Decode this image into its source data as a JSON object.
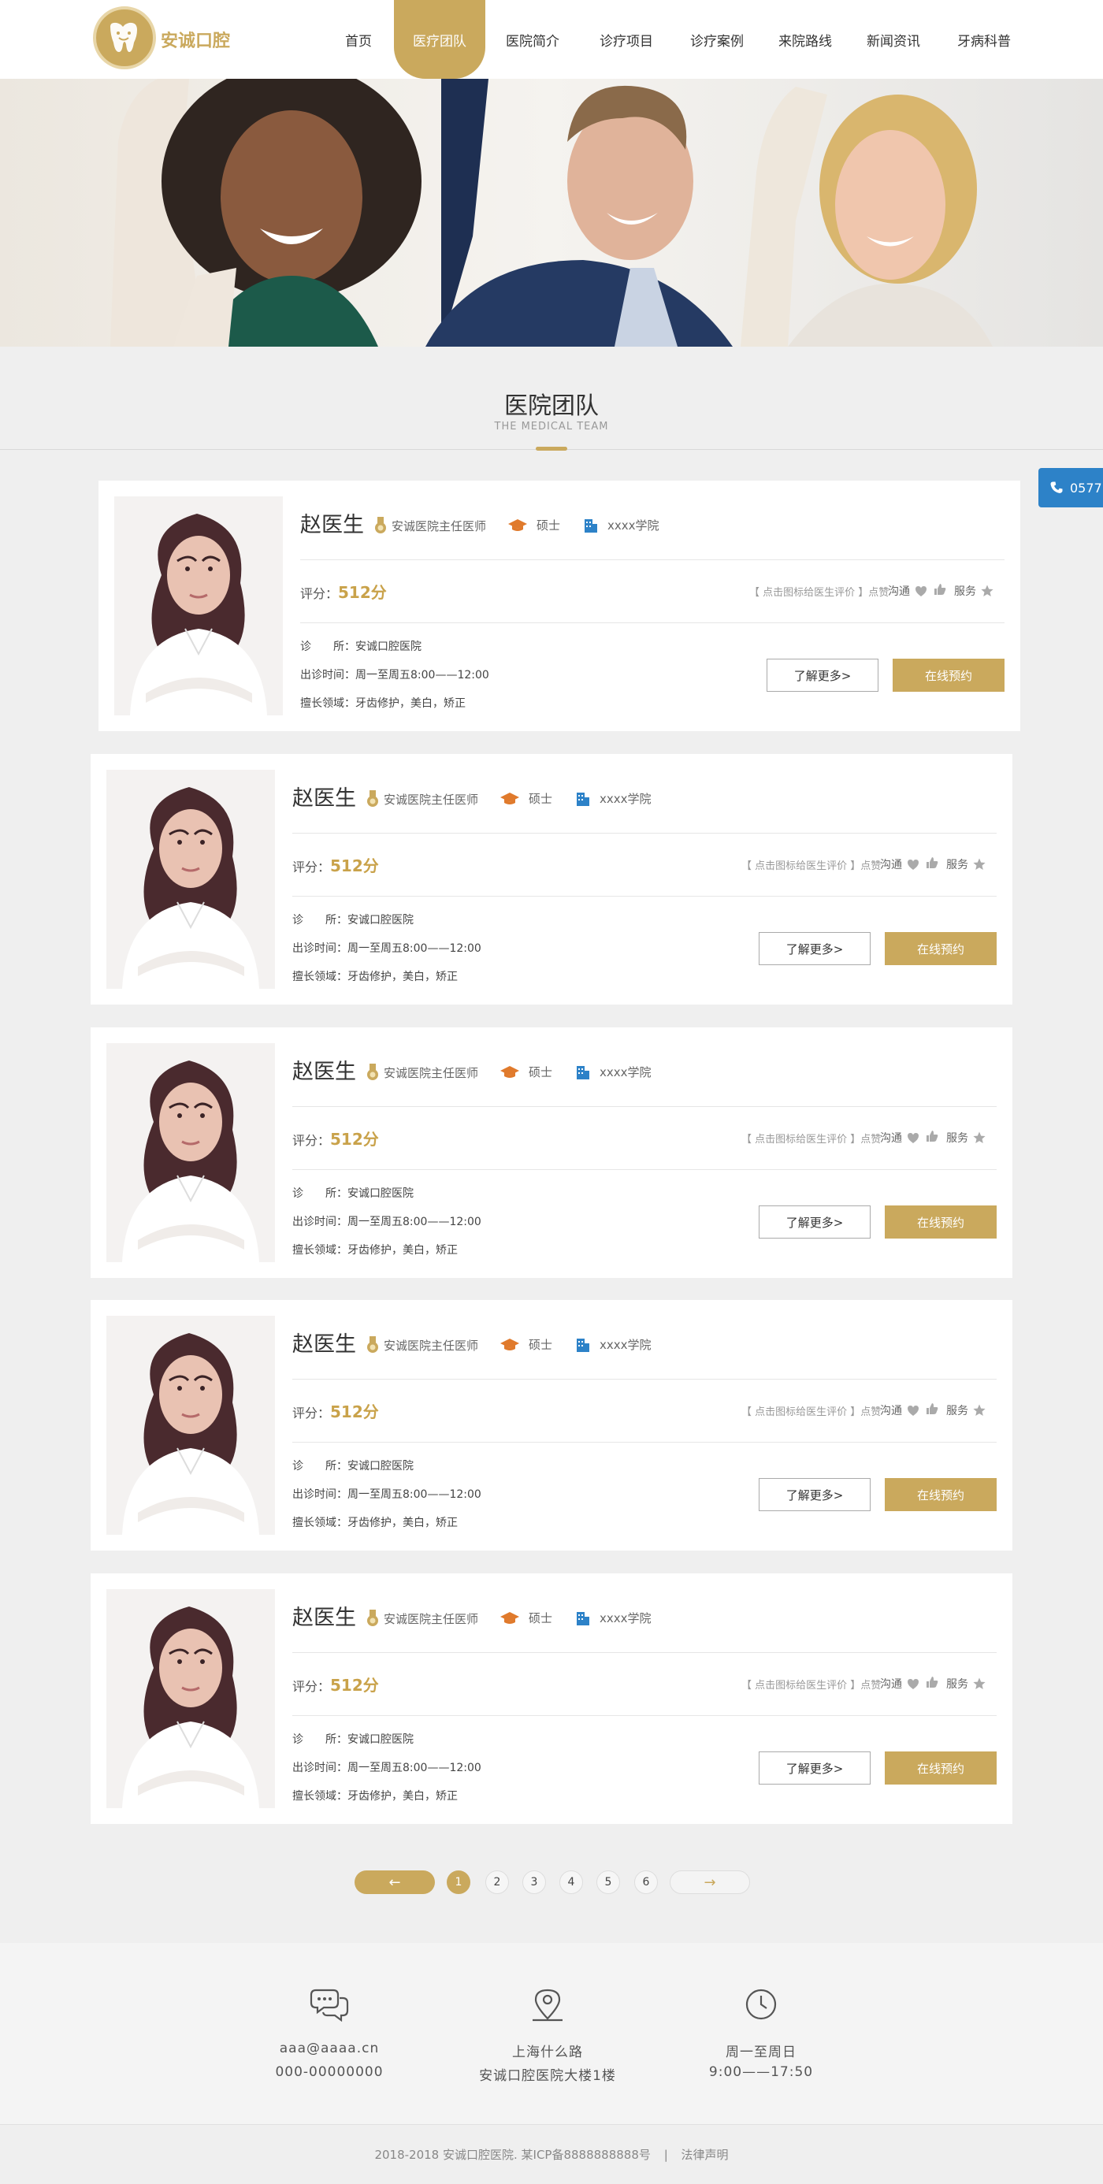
{
  "site": {
    "logo_text": "安诚口腔"
  },
  "nav": [
    {
      "label": "首页",
      "w": 90
    },
    {
      "label": "医疗团队",
      "w": 116,
      "active": true
    },
    {
      "label": "医院简介",
      "w": 120
    },
    {
      "label": "诊疗项目",
      "w": 118
    },
    {
      "label": "诊疗案例",
      "w": 112
    },
    {
      "label": "来院路线",
      "w": 112
    },
    {
      "label": "新闻资讯",
      "w": 112
    },
    {
      "label": "牙病科普",
      "w": 118
    }
  ],
  "section": {
    "title": "医院团队",
    "subtitle": "THE MEDICAL TEAM"
  },
  "tel_tab": {
    "label": "0577"
  },
  "doctor_card": {
    "name": "赵医生",
    "title": "安诚医院主任医师",
    "degree": "硕士",
    "school": "xxxx学院",
    "score_label": "评分：",
    "score": "512分",
    "hint": "【 点击图标给医生评价 】点赞",
    "communicate": "沟通",
    "service": "服务",
    "clinic": "诊　　所：安诚口腔医院",
    "hours": "出诊时间：周一至周五8:00——12:00",
    "specialty": "擅长领域：牙齿修护，美白，矫正",
    "btn_more": "了解更多>",
    "btn_book": "在线预约"
  },
  "pagination": {
    "prev": "←",
    "next": "→",
    "pages": [
      "1",
      "2",
      "3",
      "4",
      "5",
      "6"
    ],
    "current": "1"
  },
  "footer": {
    "email": "aaa@aaaa.cn",
    "phone": "000-00000000",
    "address_line1": "上海什么路",
    "address_line2": "安诚口腔医院大楼1楼",
    "hours_line1": "周一至周日",
    "hours_line2": "9:00——17:50",
    "copyright": "2018-2018 安诚口腔医院. 某ICP备8888888888号",
    "separator": "|",
    "legal": "法律声明"
  },
  "colors": {
    "accent": "#caa95d",
    "blue": "#2d82c8",
    "orange": "#e07a2c"
  }
}
